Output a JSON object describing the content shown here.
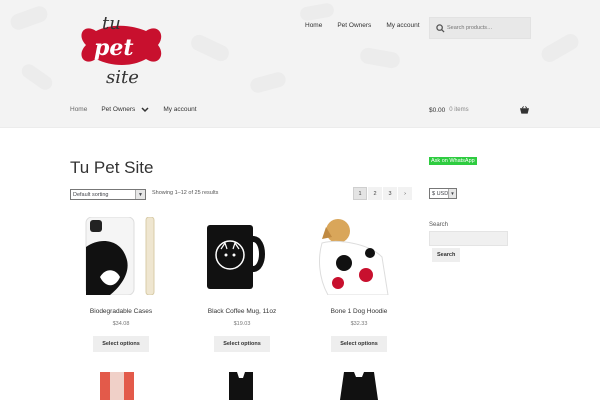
{
  "header": {
    "logo_alt": "tu pet site",
    "top_nav": [
      "Home",
      "Pet Owners",
      "My account"
    ],
    "search_placeholder": "Search products…",
    "main_nav": {
      "home": "Home",
      "pet_owners": "Pet Owners",
      "my_account": "My account"
    },
    "cart": {
      "amount": "$0.00",
      "count": "0 items"
    }
  },
  "main": {
    "title": "Tu Pet Site",
    "sort_label": "Default sorting",
    "showing": "Showing 1–12 of 25 results",
    "pages": [
      "1",
      "2",
      "3",
      "›"
    ],
    "products": [
      {
        "name": "Biodegradable Cases",
        "price": "$34.08",
        "button": "Select options"
      },
      {
        "name": "Black Coffee Mug, 11oz",
        "price": "$19.03",
        "button": "Select options"
      },
      {
        "name": "Bone 1 Dog Hoodie",
        "price": "$32.33",
        "button": "Select options"
      }
    ]
  },
  "sidebar": {
    "whatsapp": "Ask on WhatsApp",
    "currency": "$ USD",
    "search_label": "Search",
    "search_button": "Search"
  },
  "colors": {
    "accent_green": "#2ecc40",
    "logo_red": "#c8102e",
    "header_bg": "#f3f3f3"
  }
}
